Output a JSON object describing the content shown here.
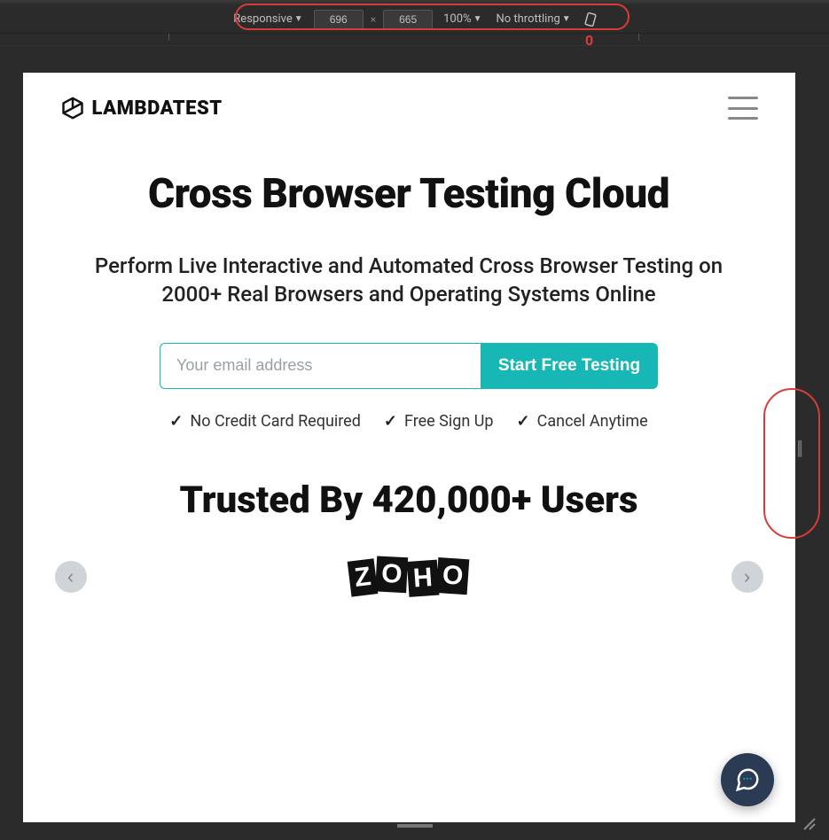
{
  "devtools": {
    "device_mode": "Responsive",
    "width": "696",
    "height": "665",
    "zoom": "100%",
    "throttling": "No throttling"
  },
  "annotations": {
    "top_label": "0"
  },
  "site": {
    "logo_text": "LAMBDATEST",
    "hero_title": "Cross Browser Testing Cloud",
    "subtitle_line1": "Perform Live Interactive and Automated Cross Browser Testing on",
    "subtitle_line2": "2000+ Real Browsers and Operating Systems Online",
    "email_placeholder": "Your email address",
    "cta_label": "Start Free Testing",
    "features": [
      "No Credit Card Required",
      "Free Sign Up",
      "Cancel Anytime"
    ],
    "trusted_title": "Trusted By 420,000+ Users",
    "client_logo": "ZOHO",
    "carousel_prev": "‹",
    "carousel_next": "›"
  }
}
